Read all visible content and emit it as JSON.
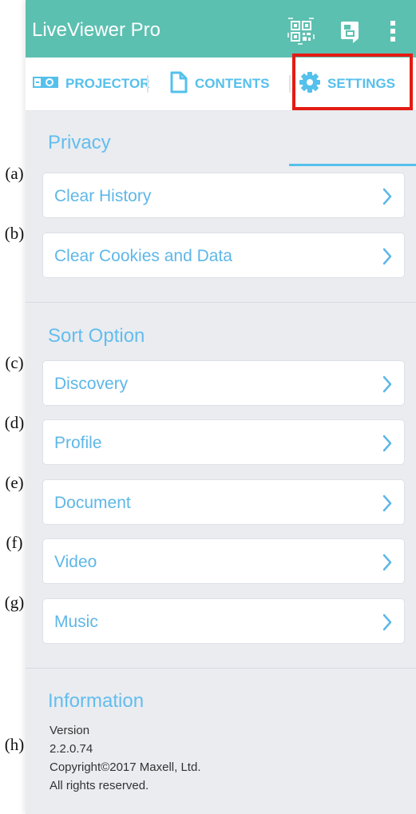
{
  "app_bar": {
    "title": "LiveViewer Pro",
    "icons": [
      "qr-code-icon",
      "cast-screen-icon",
      "more-vert-icon"
    ],
    "background": "#5cc0b1"
  },
  "tabs": [
    {
      "label": "PROJECTOR",
      "icon": "projector-icon"
    },
    {
      "label": "CONTENTS",
      "icon": "document-icon"
    },
    {
      "label": "SETTINGS",
      "icon": "gear-icon",
      "selected": true
    }
  ],
  "accent_color": "#55c0ec",
  "highlight_color": "#e41b13",
  "annotations": [
    "(a)",
    "(b)",
    "(c)",
    "(d)",
    "(e)",
    "(f)",
    "(g)",
    "(h)"
  ],
  "privacy": {
    "title": "Privacy",
    "items": [
      "Clear History",
      "Clear Cookies and Data"
    ]
  },
  "sort_option": {
    "title": "Sort Option",
    "items": [
      "Discovery",
      "Profile",
      "Document",
      "Video",
      "Music"
    ]
  },
  "information": {
    "title": "Information",
    "version_label": "Version",
    "version": "2.2.0.74",
    "copyright": "Copyright©2017 Maxell, Ltd.",
    "rights": "All rights reserved."
  }
}
